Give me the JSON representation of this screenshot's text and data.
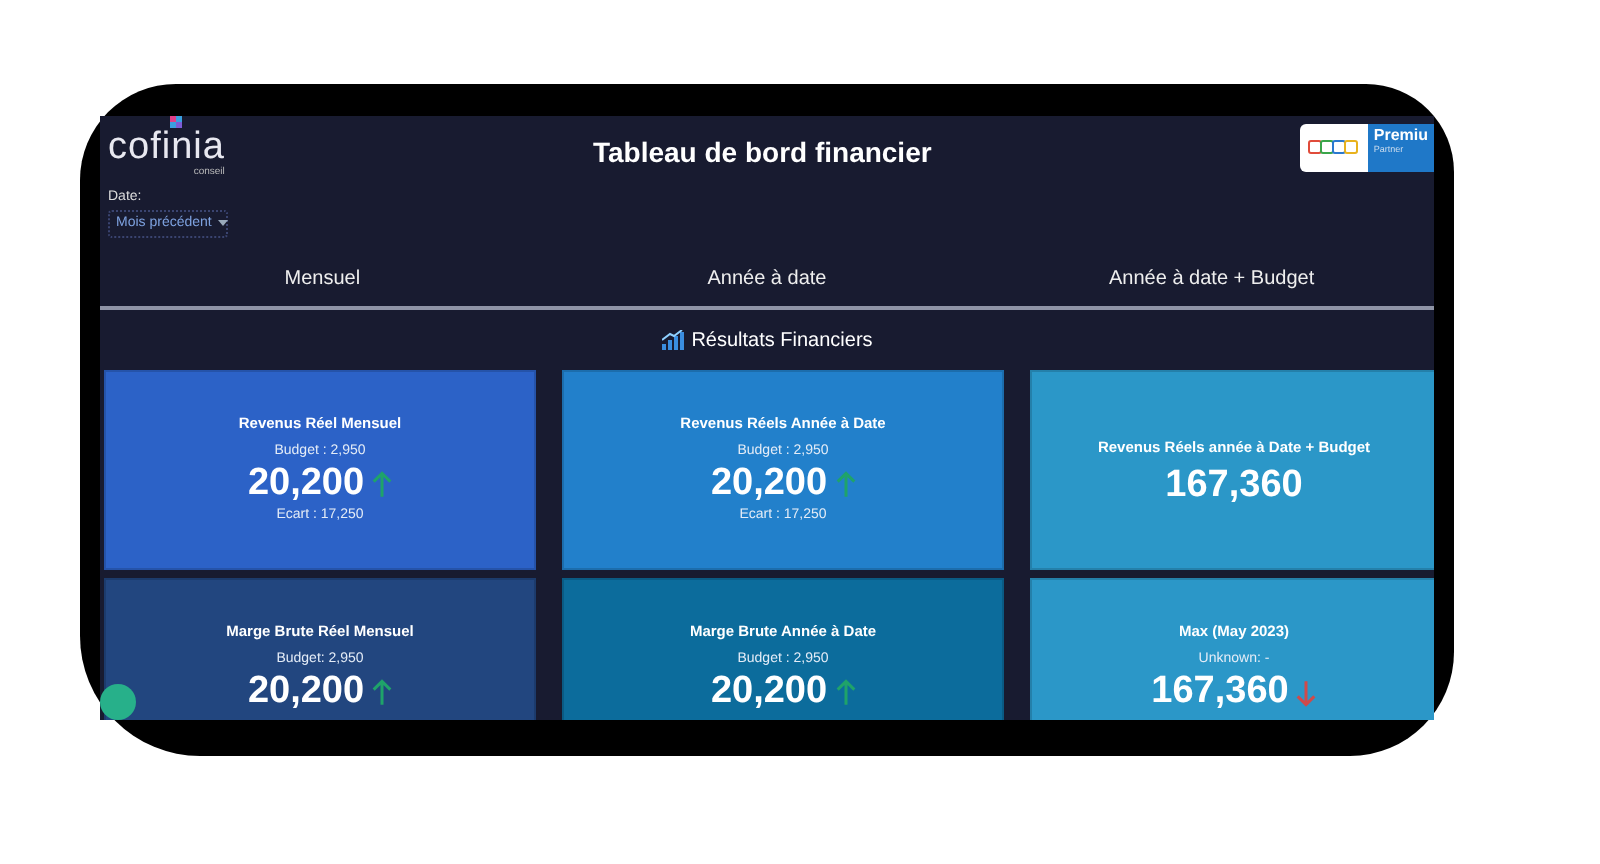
{
  "logo": {
    "name": "cofinia",
    "tagline": "conseil"
  },
  "title": "Tableau de bord financier",
  "partner_badge": {
    "title": "Premiu",
    "subtitle": "Partner"
  },
  "date_filter": {
    "label": "Date:",
    "value": "Mois précédent"
  },
  "tabs": [
    {
      "label": "Mensuel"
    },
    {
      "label": "Année à date"
    },
    {
      "label": "Année à date + Budget"
    }
  ],
  "section": {
    "title": "Résultats Financiers"
  },
  "cards": [
    {
      "title": "Revenus Réel Mensuel",
      "subtitle": "Budget : 2,950",
      "value": "20,200",
      "kind": "up",
      "footer": "Ecart : 17,250",
      "color": "#2c62c7"
    },
    {
      "title": "Revenus Réels Année à Date",
      "subtitle": "Budget : 2,950",
      "value": "20,200",
      "kind": "up",
      "footer": "Ecart : 17,250",
      "color": "#2280cb"
    },
    {
      "title": "Revenus Réels année à Date + Budget",
      "value": "167,360",
      "kind": "flat",
      "color": "#2b97c8"
    },
    {
      "title": "Marge Brute Réel Mensuel",
      "subtitle": "Budget: 2,950",
      "value": "20,200",
      "kind": "up",
      "color": "#22467f"
    },
    {
      "title": "Marge Brute Année à Date",
      "subtitle": "Budget : 2,950",
      "value": "20,200",
      "kind": "up",
      "color": "#0c6c9c"
    },
    {
      "title": "Max (May 2023)",
      "subtitle": "Unknown: -",
      "value": "167,360",
      "kind": "down",
      "color": "#2b97c8"
    }
  ]
}
